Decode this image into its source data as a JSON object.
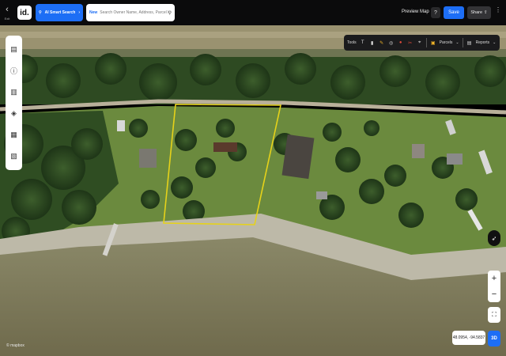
{
  "topbar": {
    "exit_label": "Exit",
    "logo_text": "id.",
    "ai_button_label": "AI Smart Search",
    "search": {
      "badge": "New",
      "placeholder": "Search Owner Name, Address, Parcel Id"
    },
    "preview_label": "Preview Map",
    "help_label": "?",
    "save_label": "Save",
    "share_label": "Share"
  },
  "toolsbar": {
    "tools_label": "Tools",
    "parcels_label": "Parcels",
    "reports_label": "Reports"
  },
  "map": {
    "coordinates": "48.0954, -94.5837",
    "attribution": "© mapbox",
    "mode_3d_label": "3D",
    "parcel_outline_color": "#e6d21a"
  },
  "colors": {
    "accent": "#1d6ef5",
    "topbar": "#0b0b0c"
  }
}
